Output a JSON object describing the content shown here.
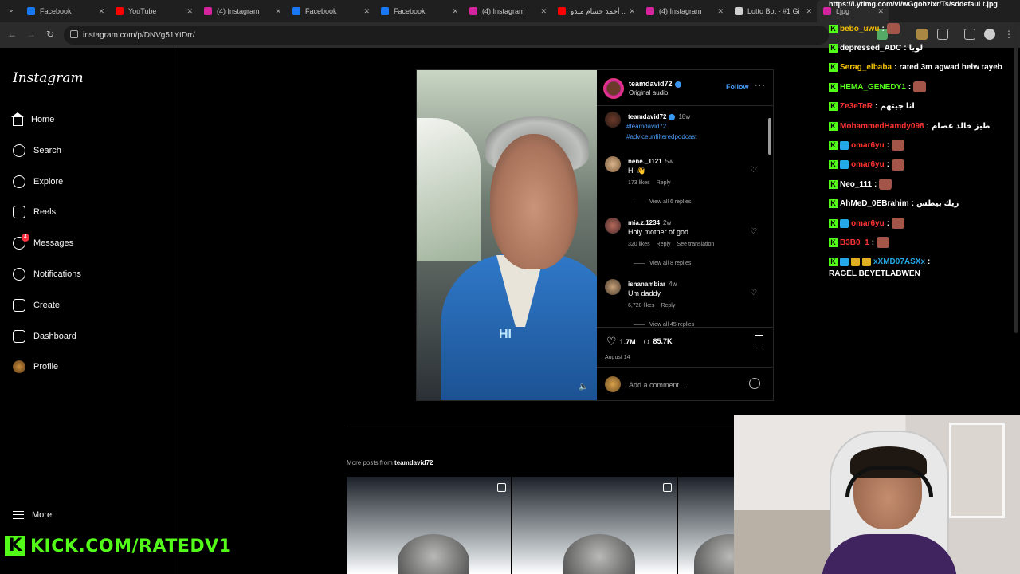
{
  "browser": {
    "tabs": [
      {
        "label": "Facebook",
        "color": "#1877f2"
      },
      {
        "label": "YouTube",
        "color": "#ff0000"
      },
      {
        "label": "(4) Instagram",
        "color": "#d6249f"
      },
      {
        "label": "Facebook",
        "color": "#1877f2"
      },
      {
        "label": "Facebook",
        "color": "#1877f2"
      },
      {
        "label": "(4) Instagram",
        "color": "#d6249f"
      },
      {
        "label": "أحمد حسام ميدو ..",
        "color": "#ff0000"
      },
      {
        "label": "(4) Instagram",
        "color": "#d6249f"
      },
      {
        "label": "Lotto Bot - #1 Gi",
        "color": "#cfcfcf"
      },
      {
        "label": "t.jpg",
        "color": "#d6249f"
      }
    ],
    "url": "instagram.com/p/DNVg51YtDrr/"
  },
  "sidebar": {
    "logo": "Instagram",
    "items": [
      {
        "label": "Home",
        "icon": "home-icon"
      },
      {
        "label": "Search",
        "icon": "search-icon"
      },
      {
        "label": "Explore",
        "icon": "compass-icon"
      },
      {
        "label": "Reels",
        "icon": "reels-icon"
      },
      {
        "label": "Messages",
        "icon": "messenger-icon",
        "badge": "4"
      },
      {
        "label": "Notifications",
        "icon": "heart-icon"
      },
      {
        "label": "Create",
        "icon": "plus-square-icon"
      },
      {
        "label": "Dashboard",
        "icon": "chart-icon"
      },
      {
        "label": "Profile",
        "icon": "avatar-icon"
      }
    ],
    "more": "More"
  },
  "stream_overlay": {
    "kick_text": "KICK.COM/RATEDV1",
    "brand_color": "#53fc18"
  },
  "post": {
    "author": "teamdavid72",
    "audio": "Original audio",
    "follow": "Follow",
    "video_text": "HI",
    "caption": {
      "user": "teamdavid72",
      "time": "18w",
      "hashtags": [
        "#teamdavid72",
        "#adviceunfilteredpodcast"
      ]
    },
    "comments": [
      {
        "user": "nene._1121",
        "time": "5w",
        "text": "Hi 👋",
        "likes": "173 likes",
        "reply": "Reply",
        "view_replies": "View all 6 replies"
      },
      {
        "user": "mia.z.1234",
        "time": "2w",
        "text": "Holy mother of god",
        "likes": "320 likes",
        "reply": "Reply",
        "translate": "See translation",
        "view_replies": "View all 8 replies"
      },
      {
        "user": "isnanambiar",
        "time": "4w",
        "text": "Um daddy",
        "likes": "6,728 likes",
        "reply": "Reply",
        "view_replies": "View all 45 replies"
      }
    ],
    "likes": "1.7M",
    "comment_count": "85.7K",
    "date": "August 14",
    "add_comment": "Add a comment..."
  },
  "more_posts": {
    "prefix": "More posts from",
    "user": "teamdavid72"
  },
  "chat": {
    "top_url": "https://i.ytimg.com/vi/wGgohzixr/Ts/sddefaul t.jpg",
    "messages": [
      {
        "user": "bebo_uwu",
        "text": "",
        "color": "#f0c000",
        "badges": [
          "k"
        ],
        "emote": true
      },
      {
        "user": "depressed_ADC",
        "text": "لويا",
        "color": "#ffffff",
        "badges": [
          "k"
        ]
      },
      {
        "user": "Serag_elbaba",
        "text": "rated 3m agwad helw tayeb",
        "color": "#f0c000",
        "badges": [
          "k"
        ]
      },
      {
        "user": "HEMA_GENEDY1",
        "text": "",
        "color": "#53fc18",
        "badges": [
          "k"
        ],
        "emote": true
      },
      {
        "user": "Ze3eTeR",
        "text": "انا جيتهم",
        "color": "#ff3333",
        "badges": [
          "k"
        ]
      },
      {
        "user": "MohammedHamdy098",
        "text": "طيز خالد عصام",
        "color": "#ff3333",
        "badges": [
          "k"
        ]
      },
      {
        "user": "omar6yu",
        "text": "",
        "color": "#ff3333",
        "badges": [
          "k",
          "b"
        ],
        "emote": true
      },
      {
        "user": "omar6yu",
        "text": "",
        "color": "#ff3333",
        "badges": [
          "k",
          "b"
        ],
        "emote": true
      },
      {
        "user": "Neo_111",
        "text": "",
        "color": "#ffffff",
        "badges": [
          "k"
        ],
        "emote": true
      },
      {
        "user": "AhMeD_0EBrahim",
        "text": "ريك بيطس",
        "color": "#ffffff",
        "badges": [
          "k"
        ]
      },
      {
        "user": "omar6yu",
        "text": "",
        "color": "#ff3333",
        "badges": [
          "k",
          "b"
        ],
        "emote": true
      },
      {
        "user": "B3B0_1",
        "text": "",
        "color": "#ff3333",
        "badges": [
          "k"
        ],
        "emote": true
      },
      {
        "user": "xXMD07ASXx",
        "text": "",
        "color": "#24a8e8",
        "badges": [
          "k",
          "b",
          "g",
          "g"
        ]
      }
    ],
    "last_line": "RAGEL BEYETLABWEN"
  }
}
